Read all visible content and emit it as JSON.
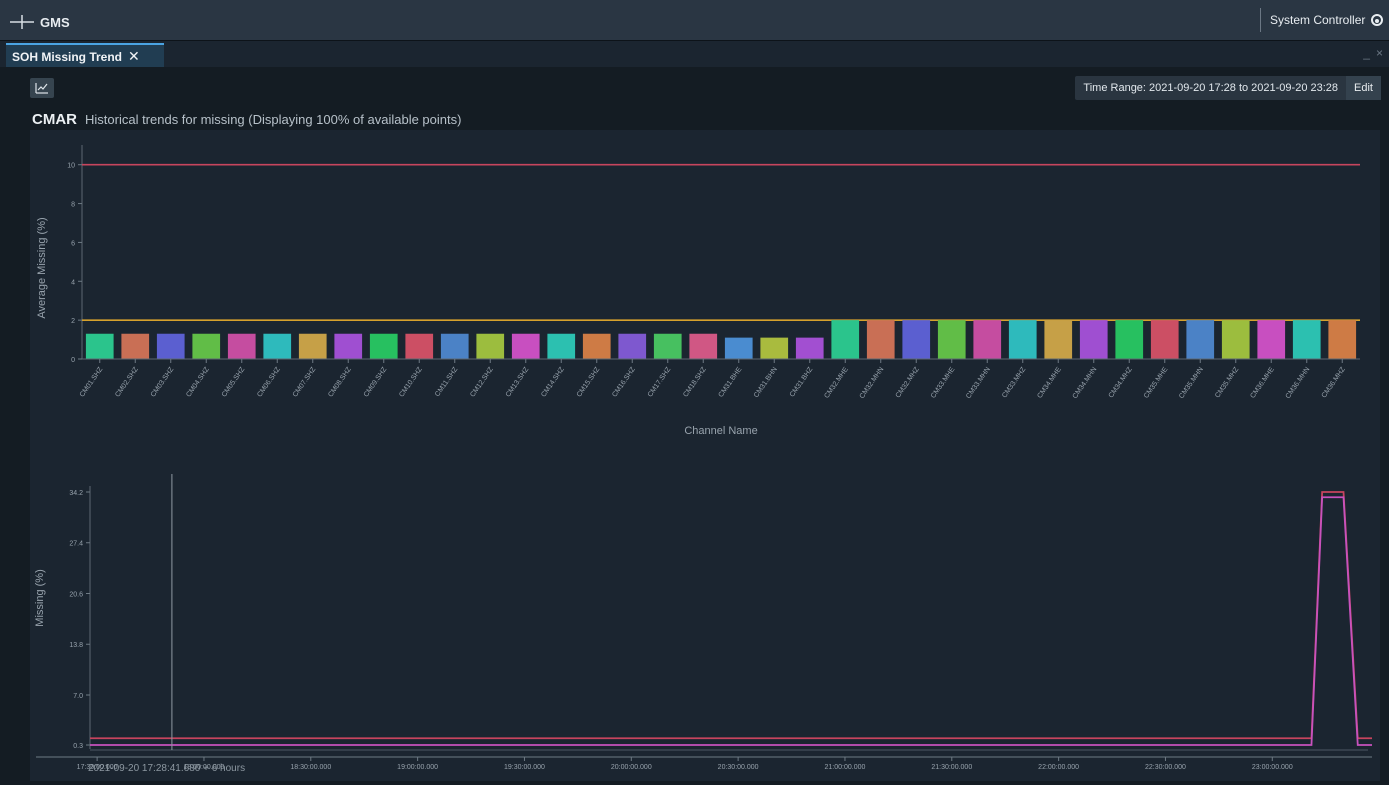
{
  "app": {
    "name": "GMS",
    "user_label": "System Controller"
  },
  "tabs": [
    {
      "label": "SOH Missing Trend",
      "close": "✕"
    }
  ],
  "window_controls": {
    "minimize": "_",
    "close": "×"
  },
  "toolbar": {
    "time_range": "Time Range: 2021-09-20 17:28 to 2021-09-20 23:28",
    "edit_label": "Edit"
  },
  "heading": {
    "station": "CMAR",
    "description": "Historical trends for missing (Displaying 100% of available points)"
  },
  "chart_data": [
    {
      "type": "bar",
      "xlabel": "Channel Name",
      "ylabel": "Average Missing (%)",
      "ylim": [
        0,
        10.5
      ],
      "yticks": [
        0,
        2,
        4,
        6,
        8,
        10
      ],
      "threshold_lines": [
        {
          "value": 10,
          "color": "#c7455d"
        },
        {
          "value": 2,
          "color": "#d6a12c"
        }
      ],
      "categories": [
        "CM01.SHZ",
        "CM02.SHZ",
        "CM03.SHZ",
        "CM04.SHZ",
        "CM05.SHZ",
        "CM06.SHZ",
        "CM07.SHZ",
        "CM08.SHZ",
        "CM09.SHZ",
        "CM10.SHZ",
        "CM11.SHZ",
        "CM12.SHZ",
        "CM13.SHZ",
        "CM14.SHZ",
        "CM15.SHZ",
        "CM16.SHZ",
        "CM17.SHZ",
        "CM18.SHZ",
        "CM31.BHE",
        "CM31.BHN",
        "CM31.BHZ",
        "CM32.MHE",
        "CM32.MHN",
        "CM32.MHZ",
        "CM33.MHE",
        "CM33.MHN",
        "CM33.MHZ",
        "CM34.MHE",
        "CM34.MHN",
        "CM34.MHZ",
        "CM35.MHE",
        "CM35.MHN",
        "CM35.MHZ",
        "CM36.MHE",
        "CM36.MHN",
        "CM36.MHZ"
      ],
      "values": [
        1.3,
        1.3,
        1.3,
        1.3,
        1.3,
        1.3,
        1.3,
        1.3,
        1.3,
        1.3,
        1.3,
        1.3,
        1.3,
        1.3,
        1.3,
        1.3,
        1.3,
        1.3,
        1.1,
        1.1,
        1.1,
        2.0,
        2.0,
        2.0,
        2.0,
        2.0,
        2.0,
        2.0,
        2.0,
        2.0,
        2.0,
        2.0,
        2.0,
        2.0,
        2.0,
        2.0
      ],
      "colors": [
        "#2bc48c",
        "#c96f55",
        "#5b5fd0",
        "#61bd47",
        "#c54da0",
        "#2ebabc",
        "#c6a047",
        "#9f4fd1",
        "#27c060",
        "#cc4f64",
        "#4b82c6",
        "#9cbd3e",
        "#c84fc0",
        "#2cc0b0",
        "#ce7b45",
        "#7e58cf",
        "#47c060",
        "#d05784",
        "#4a8cd0",
        "#a9bb3e",
        "#a24fd1",
        "#2bc48c",
        "#c96f55",
        "#5b5fd0",
        "#61bd47",
        "#c54da0",
        "#2ebabc",
        "#c6a047",
        "#9f4fd1",
        "#27c060",
        "#cc4f64",
        "#4b82c6",
        "#9cbd3e",
        "#c84fc0",
        "#2cc0b0",
        "#ce7b45"
      ]
    },
    {
      "type": "line",
      "ylabel": "Missing (%)",
      "ylim": [
        0.3,
        34.2
      ],
      "yticks": [
        "0.3",
        "7.0",
        "13.8",
        "20.6",
        "27.4",
        "34.2"
      ],
      "xticks": [
        "17:30:00.000",
        "18:00:00.000",
        "18:30:00.000",
        "19:00:00.000",
        "19:30:00.000",
        "20:00:00.000",
        "20:30:00.000",
        "21:00:00.000",
        "21:30:00.000",
        "22:00:00.000",
        "22:30:00.000",
        "23:00:00.000"
      ],
      "cursor_label": "2021-09-20 17:28:41.680 + 6 hours",
      "cursor_time": "17:51",
      "series": [
        {
          "color": "#c7445e",
          "x": [
            "17:28",
            "23:11",
            "23:14",
            "23:20",
            "23:24",
            "23:28"
          ],
          "values": [
            1.2,
            1.2,
            34.2,
            34.2,
            1.2,
            1.2
          ]
        },
        {
          "color": "#c852bd",
          "x": [
            "17:28",
            "23:11",
            "23:14",
            "23:20",
            "23:24",
            "23:28"
          ],
          "values": [
            0.3,
            0.3,
            33.5,
            33.5,
            0.3,
            0.3
          ]
        }
      ]
    }
  ]
}
